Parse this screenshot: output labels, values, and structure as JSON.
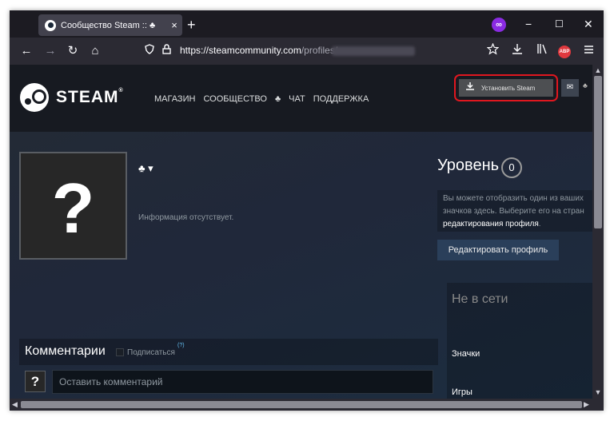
{
  "browser": {
    "tab_title": "Сообщество Steam :: ♣",
    "tab_close": "×",
    "new_tab": "+",
    "window_controls": {
      "minimize": "−",
      "maximize": "☐",
      "close": "✕"
    },
    "nav": {
      "back": "←",
      "forward": "→",
      "reload": "↻",
      "home": "⌂"
    },
    "url_host": "https://steamcommunity.com",
    "url_path": "/profiles/",
    "toolbar_icons": [
      "star-icon",
      "download-icon",
      "library-icon",
      "adblock-icon",
      "menu-icon"
    ],
    "extension_label": "∞",
    "adblock_label": "ABP"
  },
  "steam": {
    "logo_text": "STEAM",
    "logo_tm": "®",
    "nav_items": [
      "МАГАЗИН",
      "СООБЩЕСТВО",
      "♣",
      "ЧАТ",
      "ПОДДЕРЖКА"
    ],
    "install_button": "Установить Steam",
    "mail_icon": "✉",
    "small_club": "♣"
  },
  "profile": {
    "avatar_placeholder": "?",
    "persona_name": "♣ ▾",
    "no_info": "Информация отсутствует.",
    "level_label": "Уровень",
    "level_value": "0",
    "badge_hint_line1": "Вы можете отобразить один из ваших",
    "badge_hint_line2": "значков здесь. Выберите его на стран",
    "badge_hint_link": "редактирования профиля",
    "badge_hint_end": ".",
    "edit_button": "Редактировать профиль",
    "status": "Не в сети",
    "side_links": [
      "Значки",
      "Игры"
    ]
  },
  "comments": {
    "title": "Комментарии",
    "subscribe_label": "Подписаться",
    "help": "(?)",
    "avatar_placeholder": "?",
    "input_placeholder": "Оставить комментарий"
  },
  "colors": {
    "page_bg": "#1b2838",
    "header_bg": "#171a21",
    "highlight": "#e0171f",
    "link_blue": "#66c0f4"
  }
}
